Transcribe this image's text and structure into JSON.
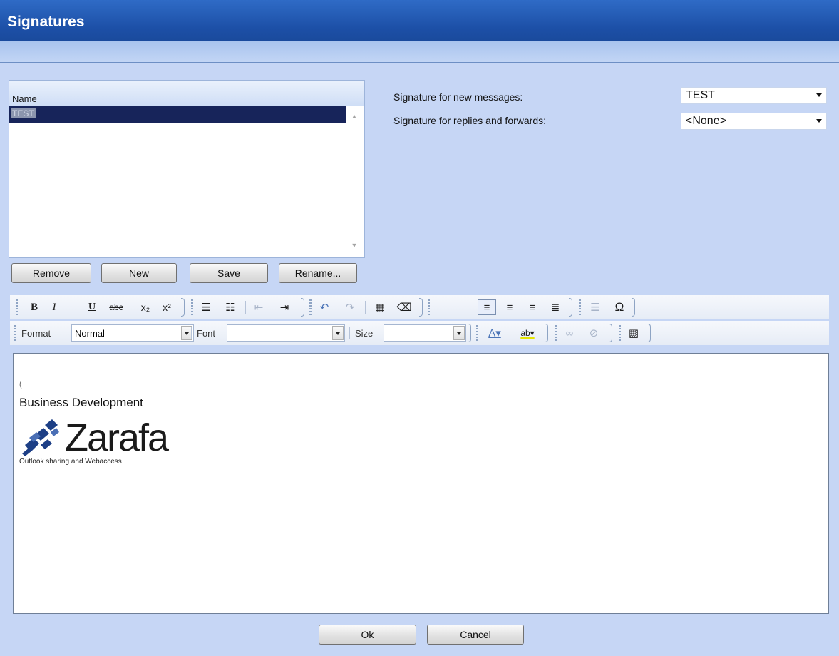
{
  "window": {
    "title": "Signatures"
  },
  "list": {
    "header": "Name",
    "items": [
      {
        "label": "TEST",
        "selected": true
      }
    ]
  },
  "list_buttons": {
    "remove": "Remove",
    "new": "New",
    "save": "Save",
    "rename": "Rename..."
  },
  "options": {
    "new_messages_label": "Signature for new messages:",
    "new_messages_value": "TEST",
    "replies_label": "Signature for replies and forwards:",
    "replies_value": "<None>"
  },
  "toolbar": {
    "format_label": "Format",
    "format_value": "Normal",
    "font_label": "Font",
    "font_value": "",
    "size_label": "Size",
    "size_value": "",
    "icons": [
      "bold-icon",
      "italic-icon",
      "underline-icon",
      "strikethrough-icon",
      "subscript-icon",
      "superscript-icon",
      "numbered-list-icon",
      "bulleted-list-icon",
      "outdent-icon",
      "indent-icon",
      "undo-icon",
      "redo-icon",
      "select-all-icon",
      "remove-format-icon",
      "align-left-icon",
      "align-center-icon",
      "align-right-icon",
      "justify-icon",
      "horizontal-rule-icon",
      "special-character-icon",
      "text-color-icon",
      "background-color-icon",
      "link-icon",
      "unlink-icon",
      "image-icon"
    ]
  },
  "editor": {
    "line1": "(",
    "line2": "Business Development",
    "logo_word": "Zarafa",
    "logo_tagline": "Outlook sharing and Webaccess"
  },
  "footer": {
    "ok": "Ok",
    "cancel": "Cancel"
  },
  "colors": {
    "titlebar": "#1c4fa6",
    "background": "#c6d6f5",
    "selection": "#17245a"
  }
}
